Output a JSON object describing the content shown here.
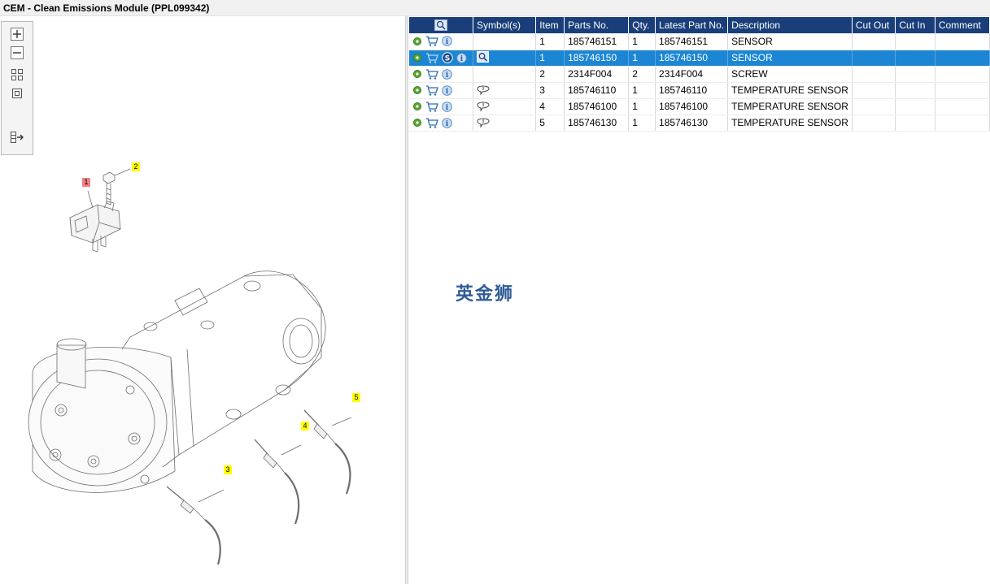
{
  "window": {
    "title": "CEM - Clean Emissions Module (PPL099342)"
  },
  "toolbar": {
    "buttons": [
      {
        "icon": "zoom-in-icon"
      },
      {
        "icon": "zoom-out-icon"
      },
      {
        "icon": "fit-all-icon"
      },
      {
        "icon": "actual-size-icon"
      },
      {
        "icon": "export-icon"
      }
    ]
  },
  "diagram": {
    "callouts": [
      "1",
      "2",
      "3",
      "4",
      "5"
    ]
  },
  "table": {
    "columns": {
      "view": "",
      "symbols": "Symbol(s)",
      "item": "Item",
      "parts_no": "Parts No.",
      "qty": "Qty.",
      "latest_part_no": "Latest Part No.",
      "description": "Description",
      "cut_out": "Cut Out",
      "cut_in": "Cut In",
      "comment": "Comment"
    },
    "rows": [
      {
        "item": "1",
        "parts_no": "185746151",
        "qty": "1",
        "latest": "185746151",
        "desc": "SENSOR",
        "cut_out": "",
        "cut_in": "",
        "comment": ""
      },
      {
        "item": "1",
        "parts_no": "185746150",
        "qty": "1",
        "latest": "185746150",
        "desc": "SENSOR",
        "cut_out": "",
        "cut_in": "",
        "comment": ""
      },
      {
        "item": "2",
        "parts_no": "2314F004",
        "qty": "2",
        "latest": "2314F004",
        "desc": "SCREW",
        "cut_out": "",
        "cut_in": "",
        "comment": ""
      },
      {
        "item": "3",
        "parts_no": "185746110",
        "qty": "1",
        "latest": "185746110",
        "desc": "TEMPERATURE SENSOR",
        "cut_out": "",
        "cut_in": "",
        "comment": ""
      },
      {
        "item": "4",
        "parts_no": "185746100",
        "qty": "1",
        "latest": "185746100",
        "desc": "TEMPERATURE SENSOR",
        "cut_out": "",
        "cut_in": "",
        "comment": ""
      },
      {
        "item": "5",
        "parts_no": "185746130",
        "qty": "1",
        "latest": "185746130",
        "desc": "TEMPERATURE SENSOR",
        "cut_out": "",
        "cut_in": "",
        "comment": ""
      }
    ],
    "selected_row": 1
  },
  "watermark": "英金狮",
  "colors": {
    "header_bg": "#1a3e7a",
    "selected_row_bg": "#1c86d4",
    "callout_yellow": "#ffff00",
    "callout_red": "#f08080"
  }
}
